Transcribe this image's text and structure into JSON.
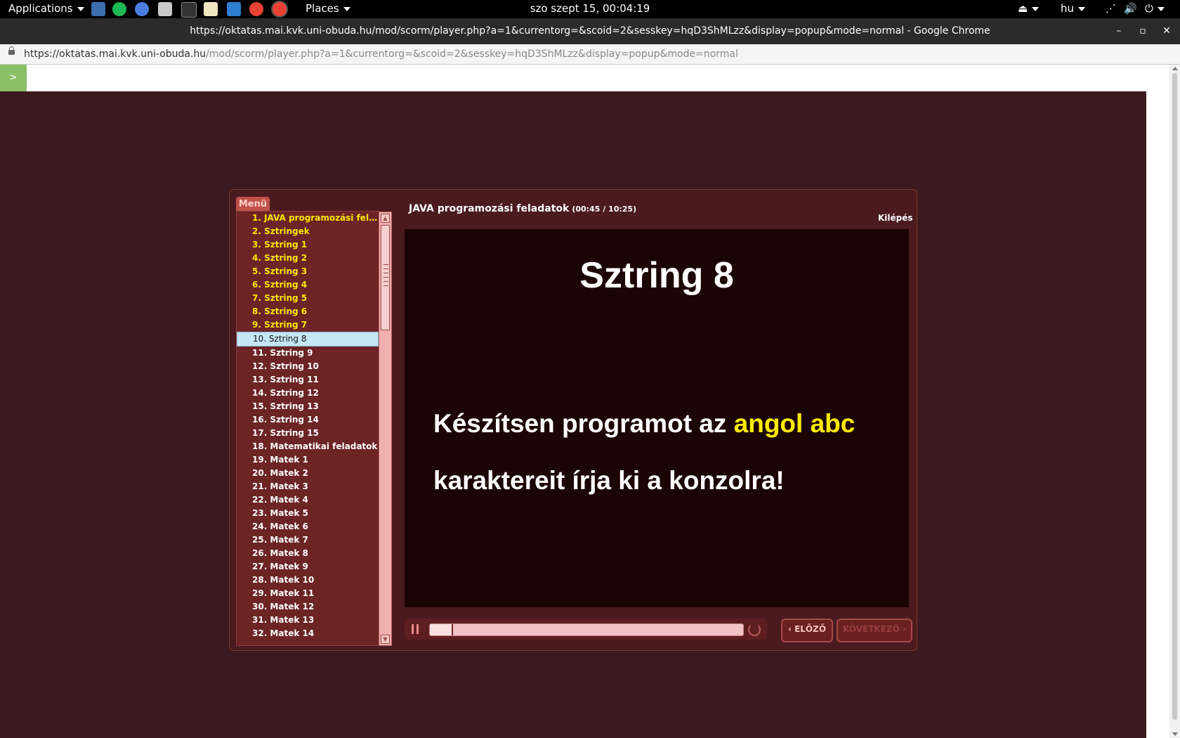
{
  "system_bar": {
    "applications": "Applications",
    "places": "Places",
    "clock": "szo szept 15, 00:04:19",
    "keyboard_layout": "hu"
  },
  "browser": {
    "window_title": "https://oktatas.mai.kvk.uni-obuda.hu/mod/scorm/player.php?a=1&currentorg=&scoid=2&sesskey=hqD3ShMLzz&display=popup&mode=normal - Google Chrome",
    "url_host": "https://oktatas.mai.kvk.uni-obuda.hu",
    "url_path": "/mod/scorm/player.php?a=1&currentorg=&scoid=2&sesskey=hqD3ShMLzz&display=popup&mode=normal",
    "toc_toggle": ">"
  },
  "player": {
    "menu_label": "Menü",
    "title": "JAVA programozási feladatok",
    "time": "(00:45 / 10:25)",
    "exit": "Kilépés",
    "prev": "‹ ELŐZŐ",
    "next": "KÖVETKEZŐ ›",
    "progress": 0.07,
    "menu_items": [
      {
        "label": "1. JAVA programozási felada...",
        "state": "visited"
      },
      {
        "label": "2. Sztringek",
        "state": "visited"
      },
      {
        "label": "3. Sztring 1",
        "state": "visited"
      },
      {
        "label": "4. Sztring 2",
        "state": "visited"
      },
      {
        "label": "5. Sztring 3",
        "state": "visited"
      },
      {
        "label": "6. Sztring  4",
        "state": "visited"
      },
      {
        "label": "7. Sztring 5",
        "state": "visited"
      },
      {
        "label": "8. Sztring 6",
        "state": "visited"
      },
      {
        "label": "9. Sztring 7",
        "state": "visited"
      },
      {
        "label": "10. Sztring 8",
        "state": "current"
      },
      {
        "label": "11. Sztring 9",
        "state": "normal"
      },
      {
        "label": "12. Sztring 10",
        "state": "normal"
      },
      {
        "label": "13. Sztring 11",
        "state": "normal"
      },
      {
        "label": "14. Sztring 12",
        "state": "normal"
      },
      {
        "label": "15. Sztring 13",
        "state": "normal"
      },
      {
        "label": "16. Sztring 14",
        "state": "normal"
      },
      {
        "label": "17. Sztring 15",
        "state": "normal"
      },
      {
        "label": "18. Matematikai feladatok",
        "state": "normal"
      },
      {
        "label": "19. Matek 1",
        "state": "normal"
      },
      {
        "label": "20. Matek 2",
        "state": "normal"
      },
      {
        "label": "21. Matek 3",
        "state": "normal"
      },
      {
        "label": "22. Matek 4",
        "state": "normal"
      },
      {
        "label": "23. Matek 5",
        "state": "normal"
      },
      {
        "label": "24. Matek 6",
        "state": "normal"
      },
      {
        "label": "25. Matek 7",
        "state": "normal"
      },
      {
        "label": "26. Matek 8",
        "state": "normal"
      },
      {
        "label": "27. Matek 9",
        "state": "normal"
      },
      {
        "label": "28. Matek 10",
        "state": "normal"
      },
      {
        "label": "29. Matek 11",
        "state": "normal"
      },
      {
        "label": "30. Matek 12",
        "state": "normal"
      },
      {
        "label": "31. Matek 13",
        "state": "normal"
      },
      {
        "label": "32. Matek 14",
        "state": "normal"
      }
    ]
  },
  "slide": {
    "heading": "Sztring 8",
    "body_part1": "Készítsen programot az ",
    "body_highlight": "angol abc",
    "body_part2": "karaktereit írja ki a konzolra!"
  },
  "colors": {
    "visited_item": "#ffe800",
    "current_item_bg": "#c4e6f5",
    "highlight": "#ffec00",
    "page_bg": "#3b1a1f"
  }
}
